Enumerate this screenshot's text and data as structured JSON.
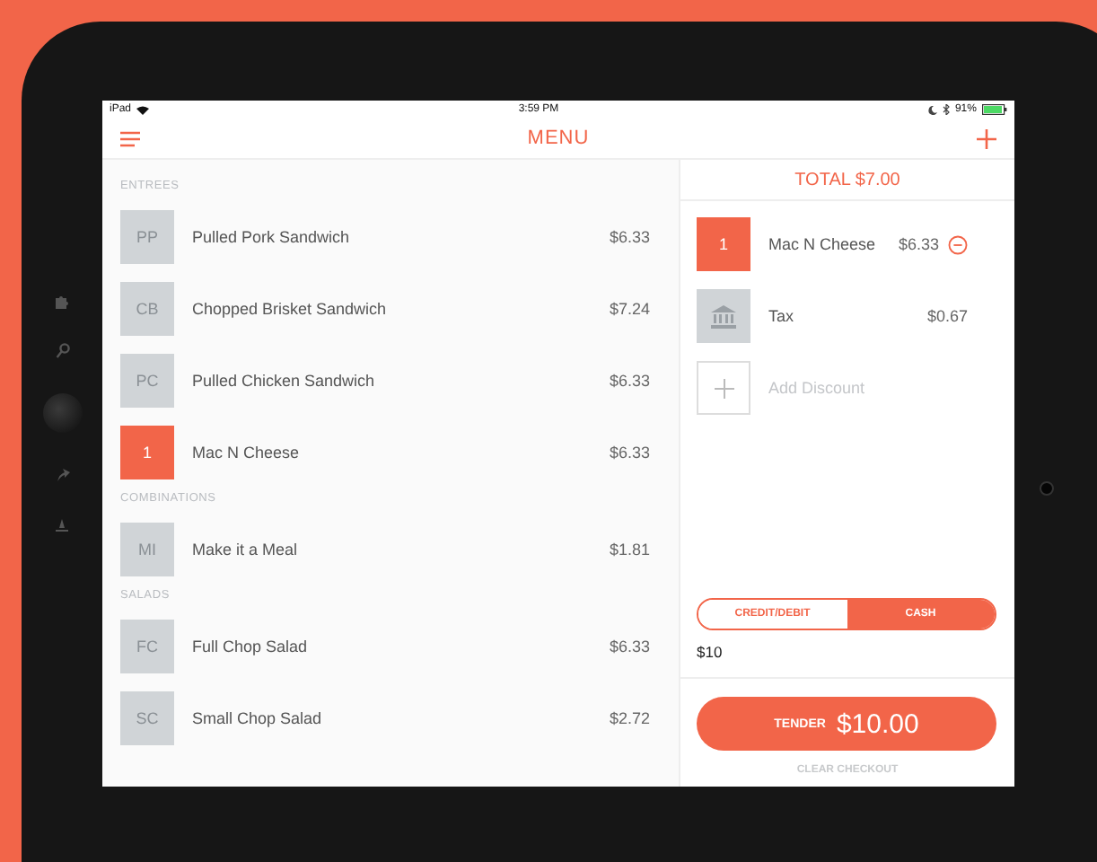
{
  "status_bar": {
    "device": "iPad",
    "time": "3:59 PM",
    "battery": "91%"
  },
  "header": {
    "title": "MENU"
  },
  "menu": {
    "sections": [
      {
        "title": "ENTREES",
        "items": [
          {
            "tile": "PP",
            "name": "Pulled Pork Sandwich",
            "price": "$6.33",
            "selected": false
          },
          {
            "tile": "CB",
            "name": "Chopped Brisket Sandwich",
            "price": "$7.24",
            "selected": false
          },
          {
            "tile": "PC",
            "name": "Pulled Chicken Sandwich",
            "price": "$6.33",
            "selected": false
          },
          {
            "tile": "1",
            "name": "Mac N Cheese",
            "price": "$6.33",
            "selected": true
          }
        ]
      },
      {
        "title": "COMBINATIONS",
        "items": [
          {
            "tile": "MI",
            "name": "Make it a Meal",
            "price": "$1.81",
            "selected": false
          }
        ]
      },
      {
        "title": "SALADS",
        "items": [
          {
            "tile": "FC",
            "name": "Full Chop Salad",
            "price": "$6.33",
            "selected": false
          },
          {
            "tile": "SC",
            "name": "Small Chop Salad",
            "price": "$2.72",
            "selected": false
          }
        ]
      }
    ]
  },
  "order": {
    "total": "TOTAL $7.00",
    "lines": [
      {
        "kind": "item",
        "tile": "1",
        "name": "Mac N Cheese",
        "price": "$6.33"
      },
      {
        "kind": "tax",
        "name": "Tax",
        "price": "$0.67"
      },
      {
        "kind": "discount",
        "name": "Add Discount"
      }
    ],
    "payment_tabs": [
      {
        "label": "CREDIT/DEBIT",
        "selected": false
      },
      {
        "label": "CASH",
        "selected": true
      }
    ],
    "amount": "$10",
    "tender": {
      "label": "TENDER",
      "amount": "$10.00"
    },
    "clear": "CLEAR CHECKOUT"
  }
}
